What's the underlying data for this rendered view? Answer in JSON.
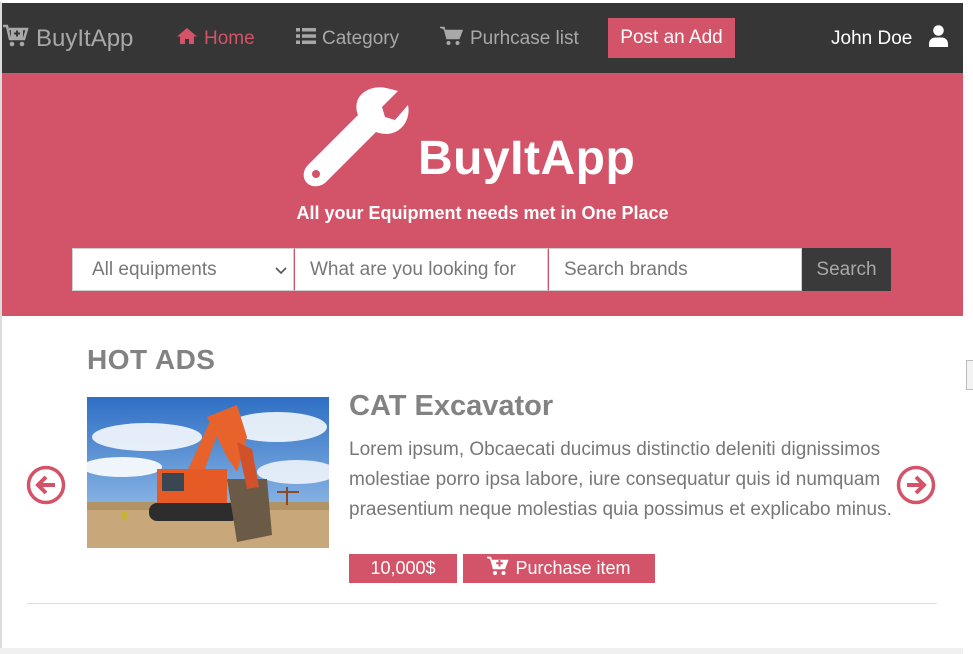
{
  "navbar": {
    "brand": "BuyItApp",
    "items": [
      {
        "label": "Home",
        "icon": "home-icon",
        "active": true
      },
      {
        "label": "Category",
        "icon": "list-icon",
        "active": false
      },
      {
        "label": "Purhcase list",
        "icon": "cart-icon",
        "active": false
      }
    ],
    "post_button": "Post an Add",
    "user_name": "John Doe"
  },
  "hero": {
    "title": "BuyItApp",
    "tagline": "All your Equipment needs met in One Place",
    "search": {
      "category_value": "All equipments",
      "query_placeholder": "What are you looking for",
      "brand_placeholder": "Search brands",
      "button_label": "Search"
    }
  },
  "hot_ads": {
    "section_title": "HOT ADS",
    "ad": {
      "title": "CAT Excavator",
      "description": "Lorem ipsum, Obcaecati ducimus distinctio deleniti dignissimos molestiae porro ipsa labore, iure consequatur quis id numquam praesentium neque molestias quia possimus et explicabo minus.",
      "price": "10,000$",
      "purchase_label": "Purchase item"
    }
  },
  "colors": {
    "accent": "#d35368",
    "navbar_bg": "#363636",
    "muted_text": "#828282"
  }
}
